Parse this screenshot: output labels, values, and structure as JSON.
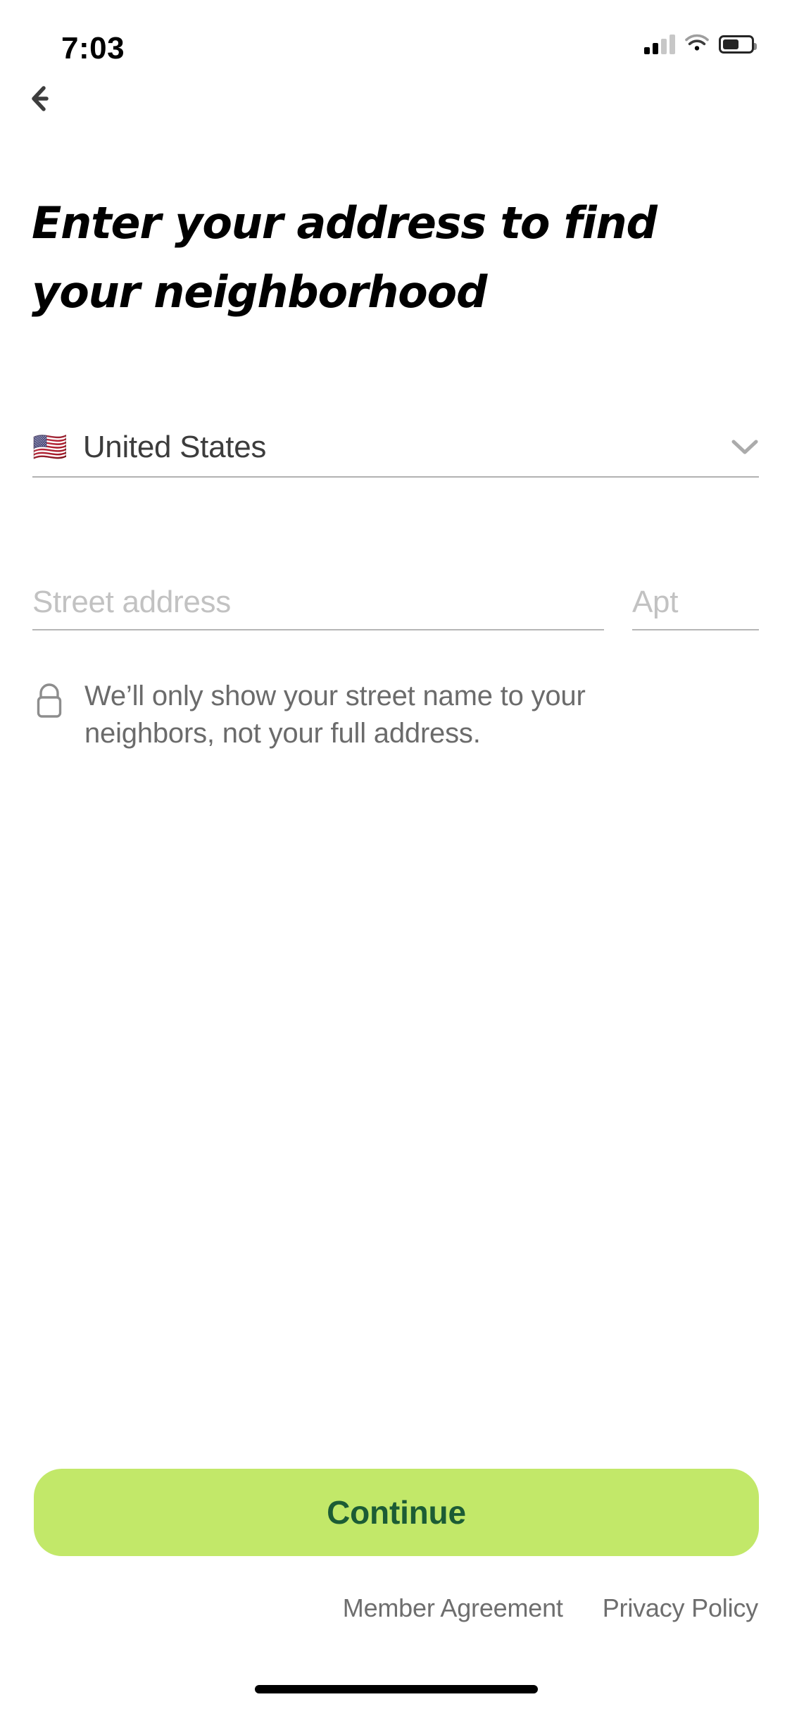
{
  "status_bar": {
    "time": "7:03",
    "signal_icon": "cellular-signal-icon",
    "signal_bars_filled": 2,
    "signal_bars_total": 4,
    "wifi_icon": "wifi-icon",
    "battery_icon": "battery-icon",
    "battery_level_percent": 50
  },
  "nav": {
    "back_icon": "arrow-left-icon"
  },
  "header": {
    "title": "Enter your address to find your neighborhood"
  },
  "country_selector": {
    "flag": "🇺🇸",
    "flag_icon": "us-flag-icon",
    "name": "United States",
    "chevron_icon": "chevron-down-icon"
  },
  "address_form": {
    "street": {
      "value": "",
      "placeholder": "Street address"
    },
    "apt": {
      "value": "",
      "placeholder": "Apt"
    }
  },
  "privacy_note": {
    "icon": "lock-icon",
    "text": "We’ll only show your street name to your neighbors, not your full address."
  },
  "footer": {
    "continue_label": "Continue",
    "member_agreement_label": "Member Agreement",
    "privacy_policy_label": "Privacy Policy"
  },
  "colors": {
    "button_bg": "#c2e869",
    "button_text": "#1c5c35",
    "title_text": "#000000",
    "body_text": "#3c3c3c",
    "muted_text": "#6b6b6b",
    "placeholder_text": "#c2c2c2",
    "divider": "#b2b2b2",
    "icon_gray": "#ababab",
    "background": "#ffffff"
  }
}
